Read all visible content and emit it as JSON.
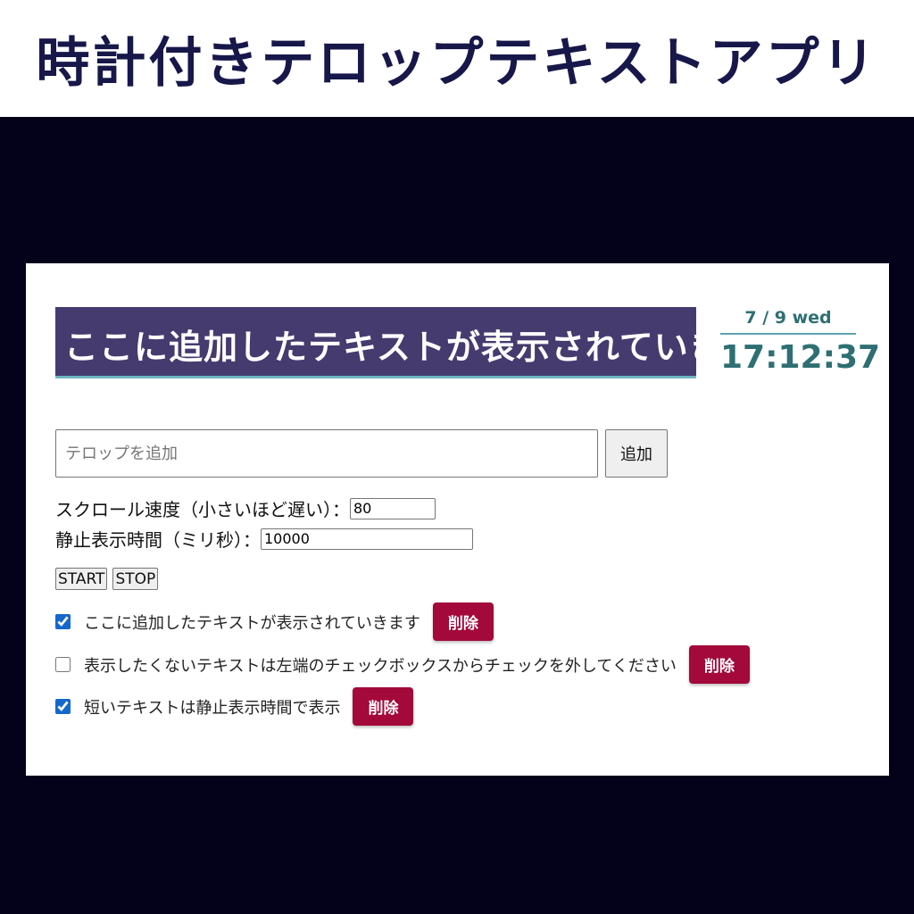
{
  "banner": {
    "title": "時計付きテロップテキストアプリ"
  },
  "ticker": {
    "text": "ここに追加したテキストが表示されていきます"
  },
  "clock": {
    "date": "7 / 9 wed",
    "time": "17:12:37"
  },
  "add_form": {
    "placeholder": "テロップを追加",
    "add_label": "追加"
  },
  "settings": {
    "speed_label": "スクロール速度（小さいほど遅い）：",
    "speed_value": "80",
    "still_label": "静止表示時間（ミリ秒）：",
    "still_value": "10000"
  },
  "controls": {
    "start_label": "START",
    "stop_label": "STOP"
  },
  "items": [
    {
      "checked": true,
      "text": "ここに追加したテキストが表示されていきます",
      "delete_label": "削除"
    },
    {
      "checked": false,
      "text": "表示したくないテキストは左端のチェックボックスからチェックを外してください",
      "delete_label": "削除"
    },
    {
      "checked": true,
      "text": "短いテキストは静止表示時間で表示",
      "delete_label": "削除"
    }
  ],
  "colors": {
    "page_background": "#03021a",
    "banner_title": "#17174a",
    "ticker_background": "#463b6f",
    "clock_text": "#2e6f73",
    "delete_button": "#a3093a",
    "checkbox_accent": "#1467cc"
  }
}
